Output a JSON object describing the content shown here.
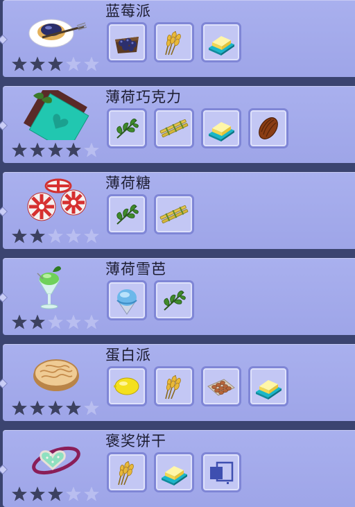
{
  "recipes": [
    {
      "name": "蓝莓派",
      "rating": 3,
      "max_rating": 5,
      "dish_icon": "blueberry-pie-icon",
      "ingredients": [
        "blueberry-icon",
        "wheat-icon",
        "butter-icon"
      ]
    },
    {
      "name": "薄荷巧克力",
      "rating": 4,
      "max_rating": 5,
      "dish_icon": "mint-chocolate-icon",
      "ingredients": [
        "mint-leaf-icon",
        "sugarcane-icon",
        "butter-icon",
        "cocoa-bean-icon"
      ]
    },
    {
      "name": "薄荷糖",
      "rating": 2,
      "max_rating": 5,
      "dish_icon": "peppermint-candy-icon",
      "ingredients": [
        "mint-leaf-icon",
        "sugarcane-icon"
      ]
    },
    {
      "name": "薄荷雪芭",
      "rating": 2,
      "max_rating": 5,
      "dish_icon": "mint-sorbet-icon",
      "ingredients": [
        "snow-ball-icon",
        "mint-leaf-icon"
      ]
    },
    {
      "name": "蛋白派",
      "rating": 4,
      "max_rating": 5,
      "dish_icon": "meringue-pie-icon",
      "ingredients": [
        "lemon-icon",
        "wheat-icon",
        "egg-tray-icon",
        "butter-icon"
      ]
    },
    {
      "name": "褒奖饼干",
      "rating": 3,
      "max_rating": 5,
      "dish_icon": "reward-cookie-icon",
      "ingredients": [
        "wheat-icon",
        "butter-icon",
        "unknown-item-icon"
      ]
    }
  ],
  "colors": {
    "panel": "#a9b0ee",
    "slot_border": "#7f86d6",
    "star_on": "#3c4160",
    "star_off": "#b9bef0"
  }
}
